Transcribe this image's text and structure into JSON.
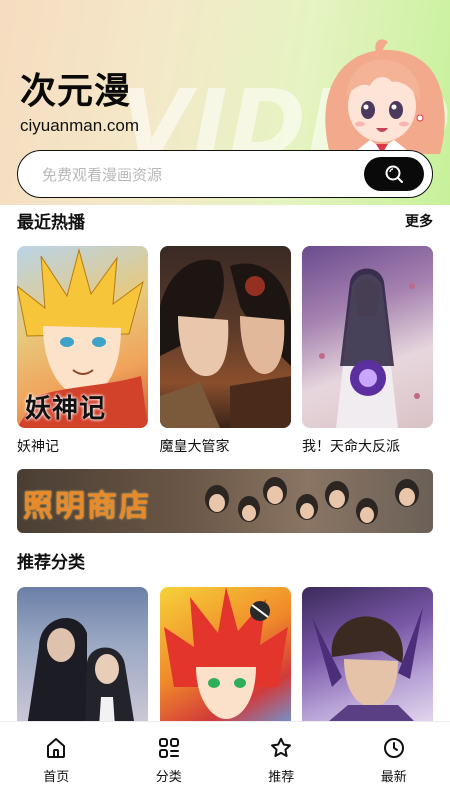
{
  "header": {
    "app_title": "次元漫",
    "domain": "ciyuanman.com",
    "watermark": "VIDEO"
  },
  "search": {
    "placeholder": "免费观看漫画资源",
    "button_icon": "search-icon"
  },
  "recent": {
    "title": "最近热播",
    "more_label": "更多",
    "items": [
      {
        "title": "妖神记",
        "cover_text": "妖神记"
      },
      {
        "title": "魔皇大管家"
      },
      {
        "title": "我！天命大反派"
      }
    ]
  },
  "banner": {
    "text": "照明商店"
  },
  "recommend": {
    "title": "推荐分类",
    "items": [
      {
        "cover": "dark-coat-duo"
      },
      {
        "cover": "red-hair-fire"
      },
      {
        "cover": "purple-warrior"
      }
    ]
  },
  "tabbar": {
    "items": [
      {
        "label": "首页",
        "icon": "home-icon"
      },
      {
        "label": "分类",
        "icon": "category-icon"
      },
      {
        "label": "推荐",
        "icon": "star-icon"
      },
      {
        "label": "最新",
        "icon": "clock-icon"
      }
    ]
  },
  "colors": {
    "accent": "#0a0a0a",
    "hero_left": "#f6dcc0",
    "hero_right": "#c6f19a",
    "banner_text": "#e8892a"
  }
}
